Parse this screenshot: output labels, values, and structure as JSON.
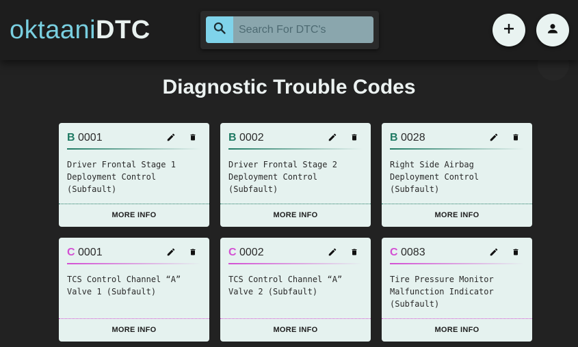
{
  "header": {
    "logo_light": "oktaani",
    "logo_bold": "DTC",
    "search_placeholder": "Search For DTC's",
    "search_icon": "search-icon",
    "add_icon": "plus-icon",
    "user_icon": "person-icon"
  },
  "main": {
    "title": "Diagnostic Trouble Codes",
    "more_info_label": "MORE INFO",
    "colors": {
      "B": "#1f7a63",
      "C": "#d34fd3"
    },
    "cards": [
      {
        "prefix": "B",
        "number": "0001",
        "description": "Driver Frontal Stage 1\nDeployment Control\n(Subfault)"
      },
      {
        "prefix": "B",
        "number": "0002",
        "description": "Driver Frontal Stage 2\nDeployment Control\n(Subfault)"
      },
      {
        "prefix": "B",
        "number": "0028",
        "description": "Right Side Airbag\nDeployment Control\n(Subfault)"
      },
      {
        "prefix": "C",
        "number": "0001",
        "description": "TCS Control Channel “A”\nValve 1 (Subfault)"
      },
      {
        "prefix": "C",
        "number": "0002",
        "description": "TCS Control Channel “A”\nValve 2 (Subfault)"
      },
      {
        "prefix": "C",
        "number": "0083",
        "description": "Tire Pressure Monitor\nMalfunction Indicator\n(Subfault)"
      }
    ]
  }
}
